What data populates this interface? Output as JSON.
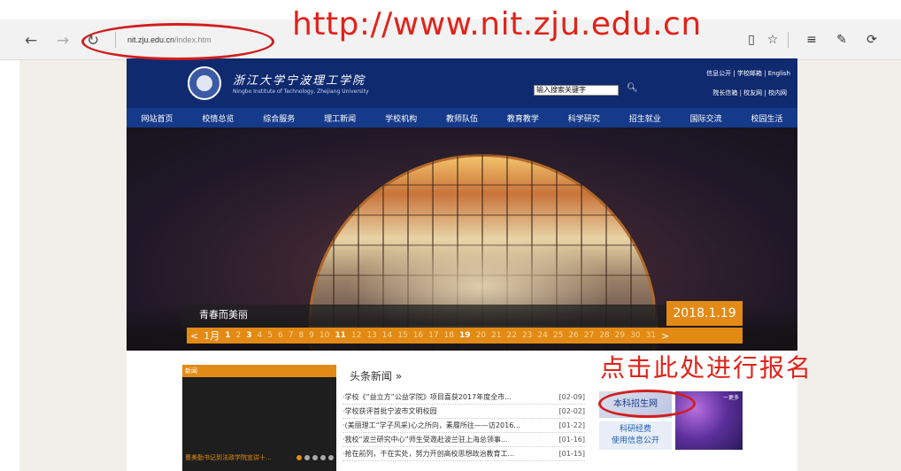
{
  "annotations": {
    "url_large": "http://www.nit.zju.edu.cn",
    "register_note": "点击此处进行报名"
  },
  "browser": {
    "address_host": "nit.zju.edu.cn",
    "address_path": "/index.htm",
    "icons": [
      "back-icon",
      "forward-icon",
      "refresh-icon",
      "reading-view-icon",
      "favorite-star-icon",
      "hub-icon",
      "notes-icon",
      "share-icon"
    ]
  },
  "site": {
    "logo_cn": "浙江大学宁波理工学院",
    "logo_en": "Ningbo Institute of Technology, Zhejiang University",
    "top_links": "信息公开 | 学校邮箱 | English",
    "top_links2": "院长信箱 | 校友网 | 校内网",
    "search_value": "输入搜索关键字",
    "nav": [
      "网站首页",
      "校情总览",
      "综合服务",
      "理工新闻",
      "学校机构",
      "教师队伍",
      "教育教学",
      "科学研究",
      "招生就业",
      "国际交流",
      "校园生活"
    ],
    "hero_caption": "青春而美丽",
    "hero_date": "2018.1.19",
    "month_label": "1月",
    "days": [
      "1",
      "2",
      "3",
      "4",
      "5",
      "6",
      "7",
      "8",
      "9",
      "10",
      "11",
      "12",
      "13",
      "14",
      "15",
      "16",
      "17",
      "18",
      "19",
      "20",
      "21",
      "22",
      "23",
      "24",
      "25",
      "26",
      "27",
      "28",
      "29",
      "30",
      "31"
    ],
    "current_day": "19",
    "news_tag": "新闻",
    "news_caption": "曹美勤书记到法政学院宣讲十...",
    "headline_title": "头条新闻 »",
    "headlines": [
      {
        "title": "·学校《“益立方”公益学院》项目喜获2017年度全市...",
        "date": "[02-09]"
      },
      {
        "title": "·学校获评首批宁波市文明校园",
        "date": "[02-02]"
      },
      {
        "title": "·(美丽理工“学子风采)心之所向，素履所往——访2016...",
        "date": "[01-22]"
      },
      {
        "title": "·我校“波兰研究中心”师生受邀赴波兰驻上海总领事...",
        "date": "[01-16]"
      },
      {
        "title": "·抢在前列，干在实处，努力开创高校思想政治教育工...",
        "date": "[01-15]"
      }
    ],
    "banner_admission": "本科招生网",
    "banner_funding_line1": "科研经费",
    "banner_funding_line2": "使用信息公开",
    "banner_more": "一更多"
  }
}
